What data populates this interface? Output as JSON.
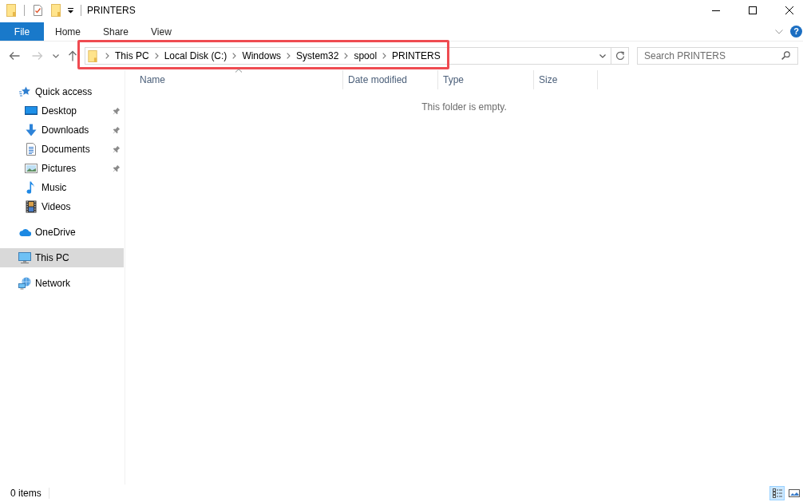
{
  "window": {
    "title": "PRINTERS"
  },
  "ribbon": {
    "tabs": [
      {
        "label": "File",
        "kind": "file"
      },
      {
        "label": "Home",
        "kind": "tab"
      },
      {
        "label": "Share",
        "kind": "tab"
      },
      {
        "label": "View",
        "kind": "tab"
      }
    ],
    "help_glyph": "?"
  },
  "nav_buttons": [
    {
      "kind": "back",
      "disabled": false
    },
    {
      "kind": "forward",
      "disabled": true
    },
    {
      "kind": "recent",
      "disabled": false
    },
    {
      "kind": "up",
      "disabled": false
    }
  ],
  "address_bar": {
    "highlighted": true,
    "path": [
      "This PC",
      "Local Disk (C:)",
      "Windows",
      "System32",
      "spool",
      "PRINTERS"
    ]
  },
  "search": {
    "placeholder": "Search PRINTERS"
  },
  "nav_pane": {
    "items": [
      {
        "label": "Quick access",
        "kind": "star",
        "selected": false,
        "children": [
          {
            "label": "Desktop",
            "kind": "desktop",
            "selected": false,
            "pinned": true
          },
          {
            "label": "Downloads",
            "kind": "download",
            "selected": false,
            "pinned": true
          },
          {
            "label": "Documents",
            "kind": "document",
            "selected": false,
            "pinned": true
          },
          {
            "label": "Pictures",
            "kind": "picture",
            "selected": false,
            "pinned": true
          },
          {
            "label": "Music",
            "kind": "music",
            "selected": false,
            "pinned": false
          },
          {
            "label": "Videos",
            "kind": "video",
            "selected": false,
            "pinned": false
          }
        ]
      },
      {
        "label": "OneDrive",
        "kind": "cloud",
        "selected": false
      },
      {
        "label": "This PC",
        "kind": "computer",
        "selected": true
      },
      {
        "label": "Network",
        "kind": "network",
        "selected": false
      }
    ]
  },
  "columns": [
    {
      "label": "Name",
      "sorted": true
    },
    {
      "label": "Date modified",
      "sorted": false
    },
    {
      "label": "Type",
      "sorted": false
    },
    {
      "label": "Size",
      "sorted": false
    }
  ],
  "empty_message": "This folder is empty.",
  "status_bar": {
    "item_count": "0 items",
    "views": [
      {
        "kind": "details",
        "selected": true
      },
      {
        "kind": "large-icons",
        "selected": false
      }
    ]
  }
}
